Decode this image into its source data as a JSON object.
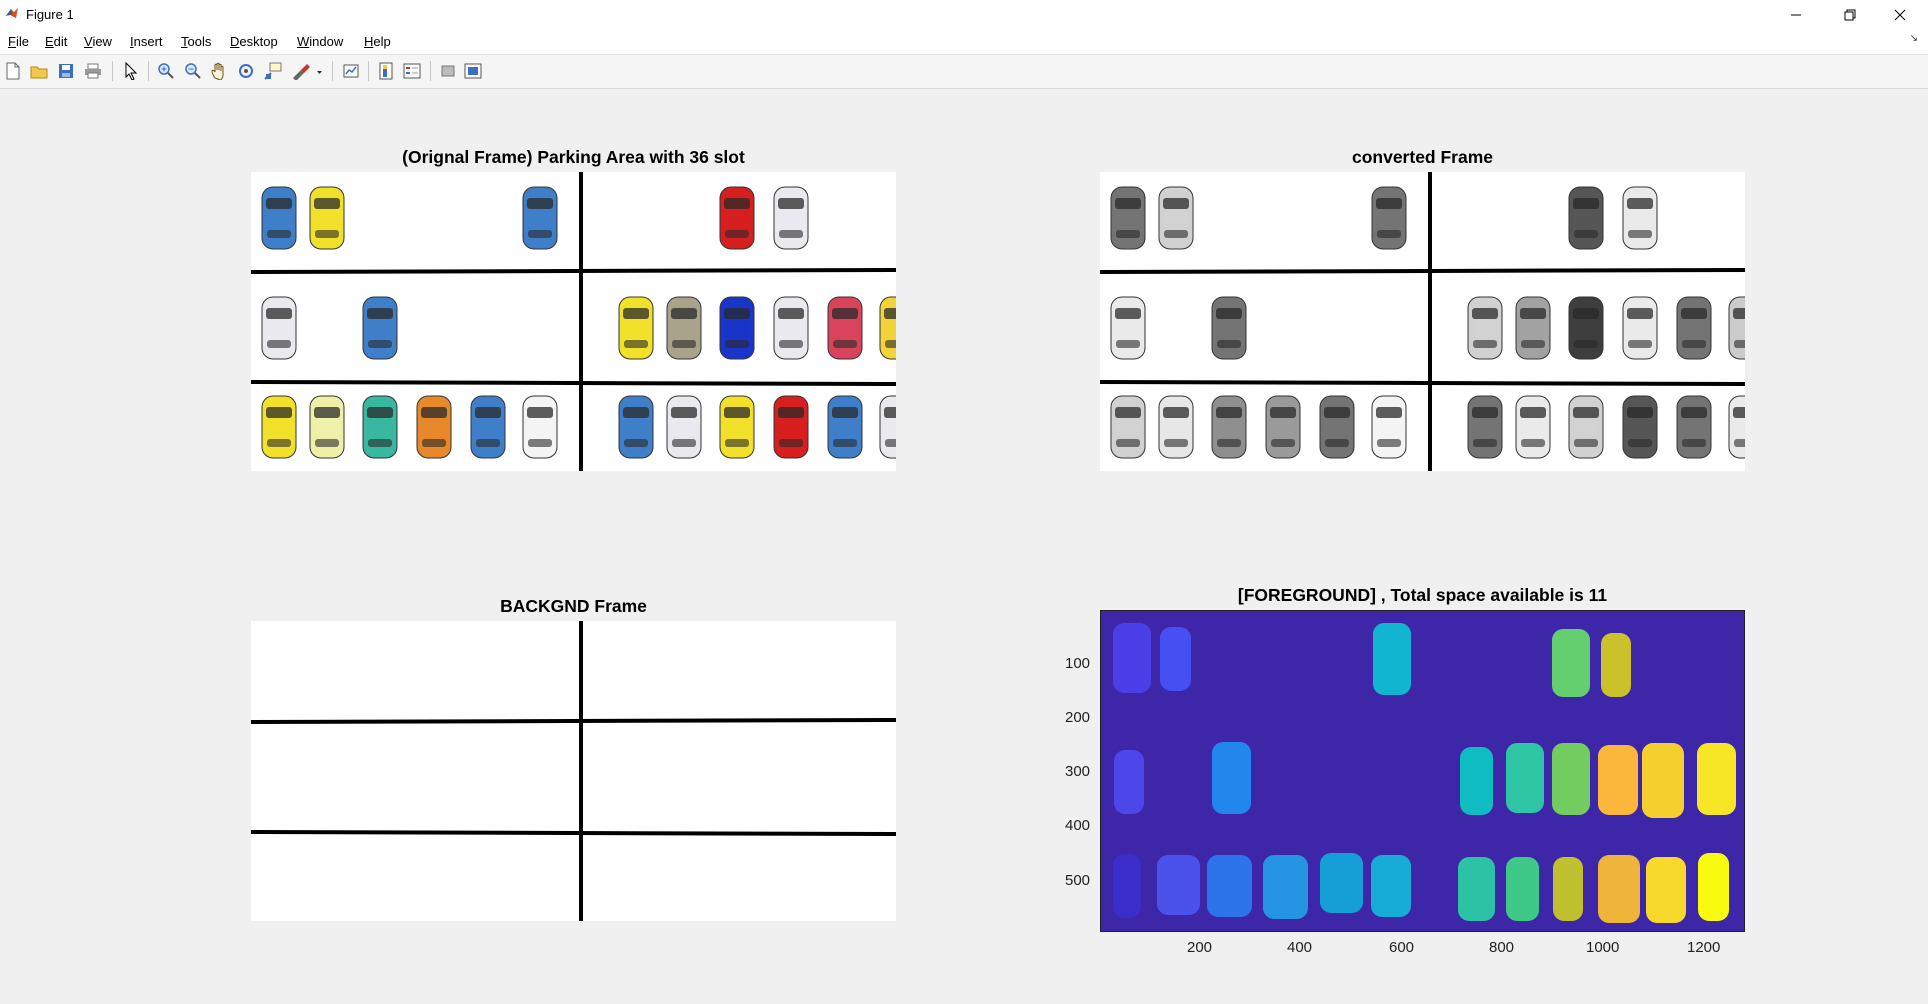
{
  "window": {
    "title": "Figure 1",
    "controls": [
      "minimize",
      "restore",
      "close"
    ]
  },
  "menu": [
    {
      "label": "File",
      "u": "F",
      "rest": "ile"
    },
    {
      "label": "Edit",
      "u": "E",
      "rest": "dit"
    },
    {
      "label": "View",
      "u": "V",
      "rest": "iew"
    },
    {
      "label": "Insert",
      "u": "I",
      "rest": "nsert"
    },
    {
      "label": "Tools",
      "u": "T",
      "rest": "ools"
    },
    {
      "label": "Desktop",
      "u": "D",
      "rest": "esktop"
    },
    {
      "label": "Window",
      "u": "W",
      "rest": "indow"
    },
    {
      "label": "Help",
      "u": "H",
      "rest": "elp"
    }
  ],
  "toolbar_icons": [
    "new-figure-icon",
    "open-file-icon",
    "save-icon",
    "print-icon",
    "edit-plot-icon",
    "zoom-in-icon",
    "zoom-out-icon",
    "pan-icon",
    "rotate-3d-icon",
    "data-cursor-icon",
    "brush-icon",
    "link-plot-icon",
    "colorbar-icon",
    "legend-icon",
    "hide-plot-tools-icon",
    "show-plot-tools-icon"
  ],
  "plots": {
    "original": {
      "title": "(Orignal Frame) Parking Area with 36 slot"
    },
    "converted": {
      "title": "converted Frame"
    },
    "background": {
      "title": "BACKGND Frame"
    },
    "foreground": {
      "title": "[FOREGROUND] , Total space available is 11",
      "x_ticks": [
        "200",
        "400",
        "600",
        "800",
        "1000",
        "1200"
      ],
      "y_ticks": [
        "100",
        "200",
        "300",
        "400",
        "500"
      ]
    }
  },
  "colors": {
    "fg_background": "#3d26a8"
  },
  "parking": {
    "rows": [
      {
        "left": [
          "blue",
          "yellow",
          null,
          null,
          null,
          "blue"
        ],
        "right": [
          null,
          null,
          "red",
          "white",
          null,
          null
        ]
      },
      {
        "left": [
          "white",
          null,
          "blue",
          null,
          null,
          null
        ],
        "right": [
          "yellow",
          "khaki",
          "royal",
          "white",
          "crimson",
          "taxi"
        ]
      },
      {
        "left": [
          "yellow",
          "cream",
          "teal",
          "orange",
          "blue",
          "police"
        ],
        "right": [
          "blue",
          "white",
          "yellow",
          "red",
          "blue",
          "white"
        ]
      }
    ]
  }
}
